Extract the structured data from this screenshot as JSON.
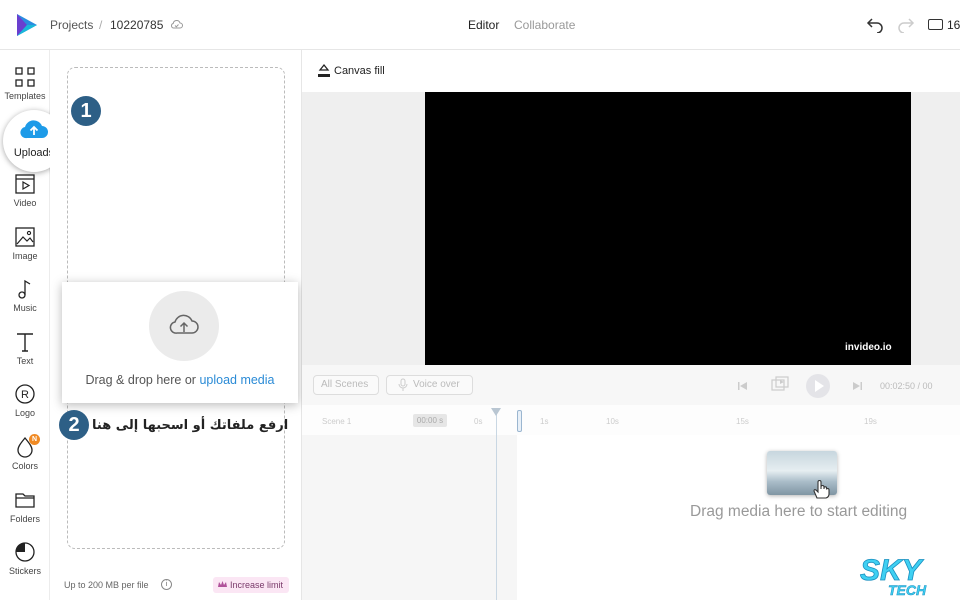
{
  "header": {
    "breadcrumb_projects": "Projects",
    "breadcrumb_sep": "/",
    "project_id": "10220785",
    "tab_editor": "Editor",
    "tab_collaborate": "Collaborate",
    "aspect_label": "16"
  },
  "rail": {
    "items": [
      {
        "label": "Templates",
        "icon": "templates-icon"
      },
      {
        "label": "Uploads",
        "icon": "upload-cloud-icon"
      },
      {
        "label": "Video",
        "icon": "video-icon"
      },
      {
        "label": "Image",
        "icon": "image-icon"
      },
      {
        "label": "Music",
        "icon": "music-icon"
      },
      {
        "label": "Text",
        "icon": "text-icon"
      },
      {
        "label": "Logo",
        "icon": "logo-icon"
      },
      {
        "label": "Colors",
        "icon": "colors-icon"
      },
      {
        "label": "Folders",
        "icon": "folder-icon"
      },
      {
        "label": "Stickers",
        "icon": "stickers-icon"
      }
    ],
    "colors_badge": "N"
  },
  "upload_panel": {
    "marker_1": "1",
    "marker_2": "2",
    "drop_text": "Drag & drop here or ",
    "drop_link": "upload media",
    "arabic_caption": "ارفع ملفاتك أو اسحبها إلى هنا",
    "footer_limit": "Up to 200 MB per file",
    "increase_limit": "Increase limit"
  },
  "stage": {
    "canvas_fill": "Canvas fill",
    "watermark": "invideo.io"
  },
  "timeline": {
    "all_scenes": "All Scenes",
    "voice_over": "Voice over",
    "time_display": "00:02:50 / 00",
    "scene_label": "Scene 1",
    "scene_duration": "00:00 s",
    "ticks": [
      "0s",
      "1s",
      "10s",
      "15s",
      "19s"
    ],
    "drag_hint": "Drag media here to start editing"
  },
  "colors": {
    "accent_blue": "#2b8bd6",
    "marker_blue": "#2d5f86",
    "badge_orange": "#f08a24",
    "upload_icon_blue": "#1e9be8"
  }
}
